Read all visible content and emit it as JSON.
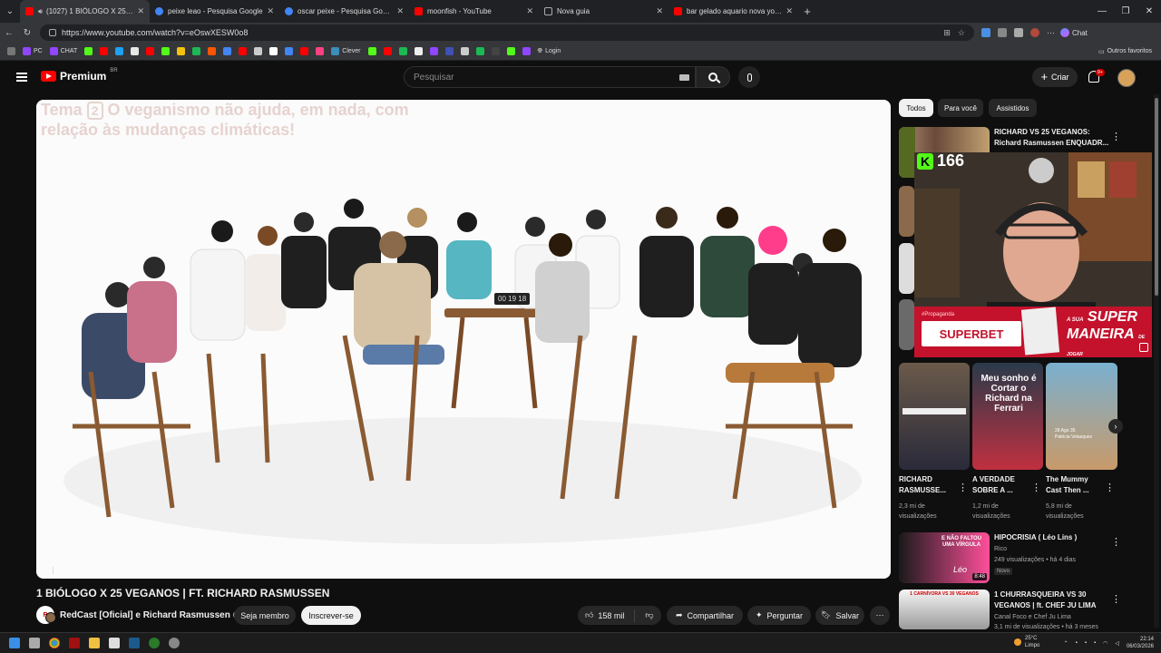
{
  "browser": {
    "tabs": [
      {
        "title": "(1027) 1 BIÓLOGO X 25 VEGANOS",
        "color": "#ff0000",
        "active": true
      },
      {
        "title": "peixe leao - Pesquisa Google",
        "color": "#4285f4"
      },
      {
        "title": "oscar peixe - Pesquisa Google",
        "color": "#4285f4"
      },
      {
        "title": "moonfish - YouTube",
        "color": "#ff0000"
      },
      {
        "title": "Nova guia",
        "color": "#888888"
      },
      {
        "title": "bar gelado aquario nova york - Yo",
        "color": "#ff0000"
      }
    ],
    "new_tab": "+",
    "url": "https://www.youtube.com/watch?v=eOswXESW0o8",
    "chat_label": "Chat",
    "bookmarks": [
      {
        "label": "PC",
        "color": "#9146ff"
      },
      {
        "label": "CHAT",
        "color": "#9146ff"
      },
      {
        "label": "",
        "color": "#53fc18"
      },
      {
        "label": "",
        "color": "#ff0000"
      },
      {
        "label": "",
        "color": "#1da1f2"
      },
      {
        "label": "",
        "color": "#e8e8e8"
      },
      {
        "label": "",
        "color": "#53fc18"
      },
      {
        "label": "",
        "color": "#f4c20d"
      },
      {
        "label": "",
        "color": "#1db954"
      },
      {
        "label": "",
        "color": "#ff5500"
      },
      {
        "label": "",
        "color": "#4285f4"
      },
      {
        "label": "Clever",
        "color": "#3c8dbc"
      },
      {
        "label": "",
        "color": "#53fc18"
      },
      {
        "label": "",
        "color": "#ff0000"
      },
      {
        "label": "",
        "color": "#9146ff"
      },
      {
        "label": "",
        "color": "#cccccc"
      },
      {
        "label": "Login",
        "color": "#cccccc"
      }
    ],
    "other_bookmarks": "Outros favoritos"
  },
  "youtube": {
    "logo_text": "Premium",
    "logo_region": "BR",
    "search_placeholder": "Pesquisar",
    "create_label": "Criar",
    "notif_count": "9+",
    "video": {
      "topic_prefix": "Tema",
      "topic_number": "2",
      "topic_text": "O veganismo não ajuda, em nada, com relação às mudanças climáticas!",
      "timer": "00 19 18",
      "title": "1 BIÓLOGO X 25 VEGANOS | FT. RICHARD RASMUSSEN",
      "channel": "RedCast [Oficial] e Richard Rasmussen",
      "channel_avatar_text": "R",
      "member_label": "Seja membro",
      "subscribe_label": "Inscrever-se",
      "likes": "158 mil",
      "share_label": "Compartilhar",
      "ask_label": "Perguntar",
      "save_label": "Salvar"
    },
    "chips": [
      "Todos",
      "Para você",
      "Assistidos"
    ],
    "related_top": {
      "title_line1": "RICHARD VS 25 VEGANOS:",
      "title_line2": "Richard Rasmussen ENQUADR..."
    },
    "kick_viewers": "166",
    "ad_text": {
      "brand": "SUPERBET",
      "tag": "#Propaganda",
      "slogan_a": "A SUA",
      "slogan_b": "SUPER",
      "slogan_c": "MANEIRA",
      "slogan_d": "DE JOGAR"
    },
    "shorts": [
      {
        "title1": "RICHARD",
        "title2": "RASMUSSE...",
        "views": "2,3 mi de",
        "views2": "visualizações"
      },
      {
        "title1": "A VERDADE",
        "title2": "SOBRE A ...",
        "views": "1,2 mi de",
        "views2": "visualizações",
        "overlay": "Meu sonho é Cortar o Richard na Ferrari"
      },
      {
        "title1": "The Mummy",
        "title2": "Cast Then ...",
        "views": "5,8 mi de",
        "views2": "visualizações",
        "overlay_small": "28 Ago 35",
        "overlay_name": "Patricia Velasquez"
      }
    ],
    "related": [
      {
        "title": "HIPOCRISIA ( Léo Lins )",
        "channel": "Rico",
        "meta": "249 visualizações • há 4 dias",
        "badge": "Novo",
        "duration": "8:48",
        "thumb_text": "E NÃO FALTOU UMA VÍRGULA",
        "thumb_sig": "Léo"
      },
      {
        "title": "1 CHURRASQUEIRA VS 30 VEGANOS | ft. CHEF JU LIMA",
        "channel": "Canal Foco e Chef Ju Lima",
        "meta": "3,1 mi de visualizações • há 3 meses",
        "thumb_text": "1 CARNÍVORA VS 30 VEGANOS"
      }
    ]
  },
  "taskbar": {
    "weather_temp": "25°C",
    "weather_desc": "Limpo",
    "time": "22:14",
    "date": "06/03/2026"
  }
}
